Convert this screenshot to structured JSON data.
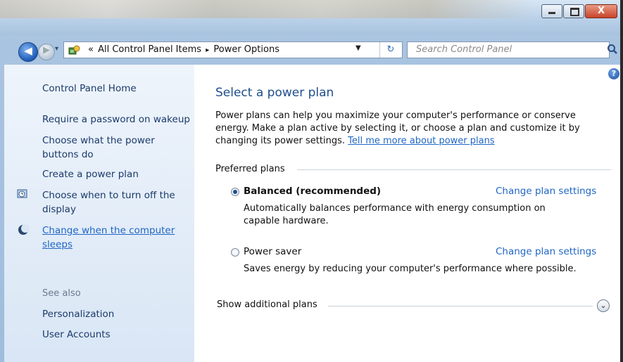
{
  "window": {
    "minimize_glyph": "",
    "maximize_glyph": "",
    "close_glyph": "X"
  },
  "nav": {
    "crumb_sep": "«",
    "crumb_1": "All Control Panel Items",
    "crumb_arrow": "▸",
    "crumb_2": "Power Options",
    "search_placeholder": "Search Control Panel"
  },
  "sidebar": {
    "home": "Control Panel Home",
    "items": [
      "Require a password on wakeup",
      "Choose what the power buttons do",
      "Create a power plan",
      "Choose when to turn off the display",
      "Change when the computer sleeps"
    ],
    "see_also_label": "See also",
    "see_also": [
      "Personalization",
      "User Accounts"
    ]
  },
  "main": {
    "title": "Select a power plan",
    "intro_text": "Power plans can help you maximize your computer's performance or conserve energy. Make a plan active by selecting it, or choose a plan and customize it by changing its power settings.",
    "intro_link": "Tell me more about power plans",
    "preferred_label": "Preferred plans",
    "plans": [
      {
        "name": "Balanced (recommended)",
        "selected": true,
        "desc": "Automatically balances performance with energy consumption on capable hardware.",
        "link": "Change plan settings"
      },
      {
        "name": "Power saver",
        "selected": false,
        "desc": "Saves energy by reducing your computer's performance where possible.",
        "link": "Change plan settings"
      }
    ],
    "additional_label": "Show additional plans"
  },
  "colors": {
    "link": "#2166c4",
    "title": "#1e4e8c"
  }
}
